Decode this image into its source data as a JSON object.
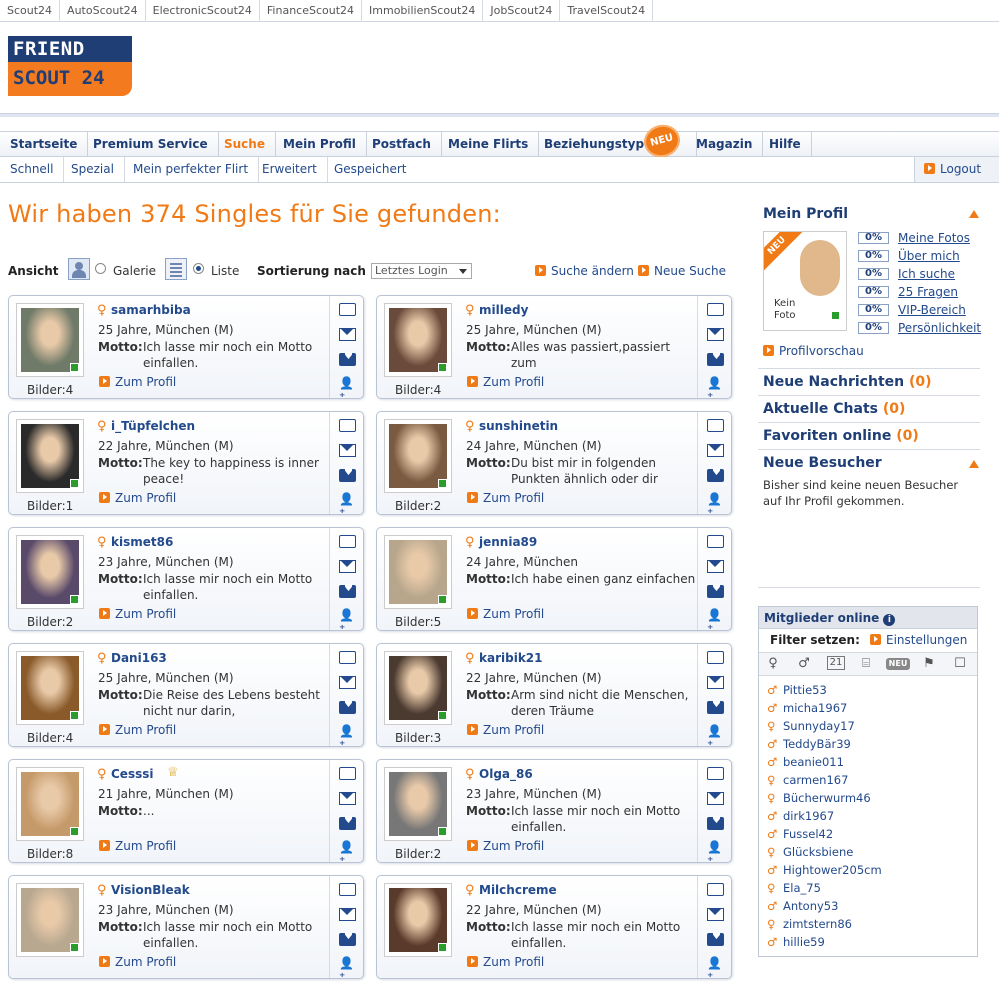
{
  "topnav": [
    "Scout24",
    "AutoScout24",
    "ElectronicScout24",
    "FinanceScout24",
    "ImmobilienScout24",
    "JobScout24",
    "TravelScout24"
  ],
  "logo": {
    "line1": "FRIEND",
    "line2": "SCOUT 24"
  },
  "mainnav": [
    "Startseite",
    "Premium Service",
    "Suche",
    "Mein Profil",
    "Postfach",
    "Meine Flirts",
    "Beziehungstyp",
    "Magazin",
    "Hilfe"
  ],
  "mainnav_active": "Suche",
  "neu_badge": "NEU",
  "subnav": [
    "Schnell",
    "Spezial",
    "Mein perfekter Flirt",
    "Erweitert",
    "Gespeichert"
  ],
  "logout": "Logout",
  "headline": "Wir haben 374 Singles für Sie gefunden:",
  "controls": {
    "ansicht": "Ansicht",
    "galerie": "Galerie",
    "liste": "Liste",
    "sortierung": "Sortierung nach",
    "sort_value": "Letztes Login",
    "suche_aendern": "Suche ändern",
    "neue_suche": "Neue Suche"
  },
  "labels": {
    "motto": "Motto:",
    "zum_profil": "Zum Profil"
  },
  "profiles": [
    {
      "name": "samarhbiba",
      "info": "25 Jahre, München (M)",
      "motto": "Ich lasse mir noch ein Motto einfallen.",
      "bilder": "Bilder:4",
      "color": "#6f7a68"
    },
    {
      "name": "milledy",
      "info": "25 Jahre, München (M)",
      "motto": "Alles was passiert,passiert zum",
      "bilder": "Bilder:4",
      "color": "#6a4a3a"
    },
    {
      "name": "i_Tüpfelchen",
      "info": "22 Jahre, München (M)",
      "motto": "The key to happiness is inner peace!",
      "bilder": "Bilder:1",
      "color": "#2a2a2a"
    },
    {
      "name": "sunshinetin",
      "info": "24 Jahre, München (M)",
      "motto": "Du bist mir in folgenden Punkten ähnlich oder dir",
      "bilder": "Bilder:2",
      "color": "#7a5a40"
    },
    {
      "name": "kismet86",
      "info": "23 Jahre, München (M)",
      "motto": "Ich lasse mir noch ein Motto einfallen.",
      "bilder": "Bilder:2",
      "color": "#5a4a6a"
    },
    {
      "name": "jennia89",
      "info": "24 Jahre, München",
      "motto": "Ich habe einen ganz einfachen",
      "bilder": "Bilder:5",
      "color": "#b7a68c"
    },
    {
      "name": "Dani163",
      "info": "25 Jahre, München (M)",
      "motto": "Die Reise des Lebens besteht nicht nur darin,",
      "bilder": "Bilder:4",
      "color": "#8a5a2a"
    },
    {
      "name": "karibik21",
      "info": "22 Jahre, München (M)",
      "motto": "Arm sind nicht die Menschen, deren Träume",
      "bilder": "Bilder:3",
      "color": "#4a3a30"
    },
    {
      "name": "Cesssi",
      "info": "21 Jahre, München (M)",
      "motto": "...",
      "bilder": "Bilder:8",
      "color": "#c59a6a",
      "crown": "♕"
    },
    {
      "name": "Olga_86",
      "info": "23 Jahre, München (M)",
      "motto": "Ich lasse mir noch ein Motto einfallen.",
      "bilder": "Bilder:2",
      "color": "#777777"
    },
    {
      "name": "VisionBleak",
      "info": "23 Jahre, München (M)",
      "motto": "Ich lasse mir noch ein Motto einfallen.",
      "bilder": "",
      "color": "#b8a890"
    },
    {
      "name": "Milchcreme",
      "info": "22 Jahre, München (M)",
      "motto": "Ich lasse mir noch ein Motto einfallen.",
      "bilder": "",
      "color": "#5a3a2a"
    }
  ],
  "right": {
    "mein_profil": "Mein Profil",
    "kein_foto": "Kein Foto",
    "neu": "NEU",
    "progress": [
      {
        "pct": "0%",
        "label": "Meine Fotos"
      },
      {
        "pct": "0%",
        "label": "Über mich"
      },
      {
        "pct": "0%",
        "label": "Ich suche"
      },
      {
        "pct": "0%",
        "label": "25 Fragen"
      },
      {
        "pct": "0%",
        "label": "VIP-Bereich"
      },
      {
        "pct": "0%",
        "label": "Persönlichkeit"
      }
    ],
    "profilvorschau": "Profilvorschau",
    "neue_nachrichten": "Neue Nachrichten",
    "neue_nachrichten_cnt": "(0)",
    "aktuelle_chats": "Aktuelle Chats",
    "aktuelle_chats_cnt": "(0)",
    "favoriten": "Favoriten online",
    "favoriten_cnt": "(0)",
    "neue_besucher": "Neue Besucher",
    "besucher_text": "Bisher sind keine neuen Besucher auf Ihr Profil gekommen."
  },
  "online": {
    "title": "Mitglieder online",
    "filter": "Filter setzen:",
    "einstellungen": "Einstellungen",
    "neu": "NEU",
    "members": [
      {
        "name": "Pittie53",
        "sex": "m"
      },
      {
        "name": "micha1967",
        "sex": "m"
      },
      {
        "name": "Sunnyday17",
        "sex": "f"
      },
      {
        "name": "TeddyBär39",
        "sex": "m"
      },
      {
        "name": "beanie011",
        "sex": "m"
      },
      {
        "name": "carmen167",
        "sex": "f"
      },
      {
        "name": "Bücherwurm46",
        "sex": "f"
      },
      {
        "name": "dirk1967",
        "sex": "m"
      },
      {
        "name": "Fussel42",
        "sex": "m"
      },
      {
        "name": "Glücksbiene",
        "sex": "f"
      },
      {
        "name": "Hightower205cm",
        "sex": "m"
      },
      {
        "name": "Ela_75",
        "sex": "f"
      },
      {
        "name": "Antony53",
        "sex": "m"
      },
      {
        "name": "zimtstern86",
        "sex": "f"
      },
      {
        "name": "hillie59",
        "sex": "m"
      }
    ]
  }
}
